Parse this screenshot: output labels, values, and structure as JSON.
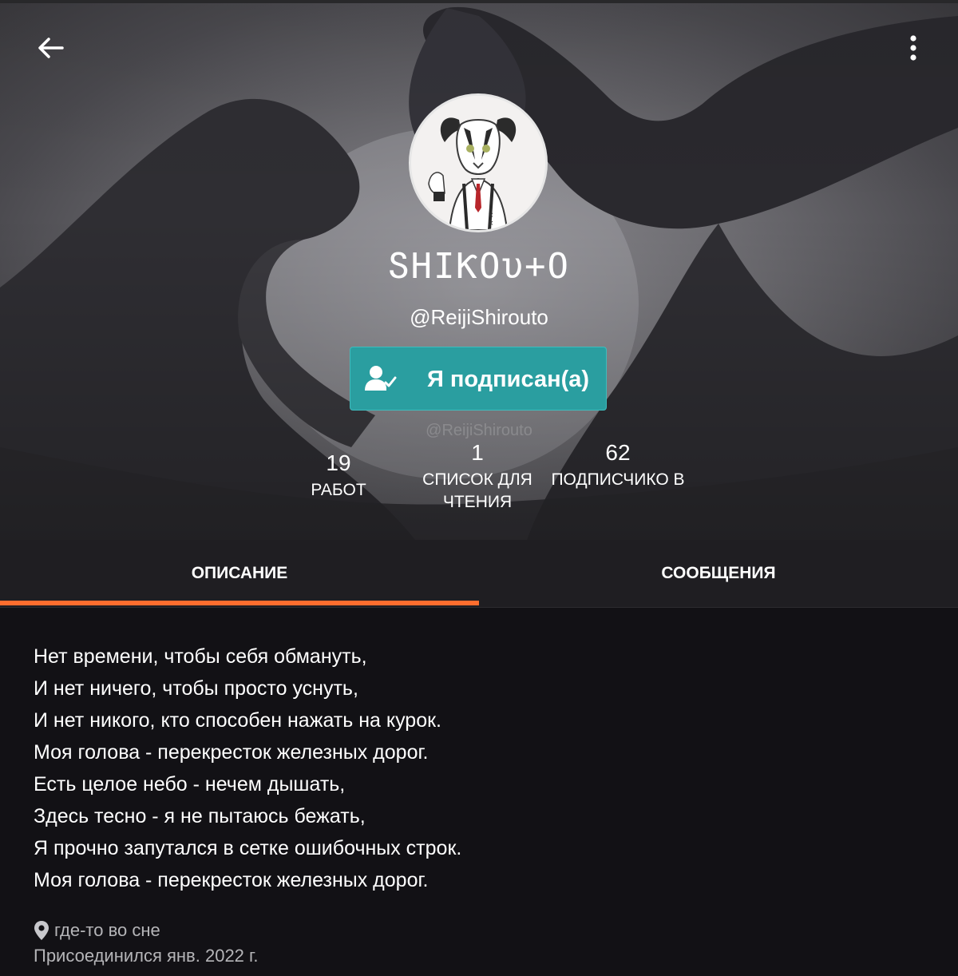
{
  "profile": {
    "display_name": "ՏHIƘOυ+O",
    "username": "@ReijiShirouto",
    "watermark": "@ReijiShirouto",
    "follow_label": "Я подписан(а)"
  },
  "stats": {
    "works": {
      "count": "19",
      "label": "РАБОТ"
    },
    "reading_lists": {
      "count": "1",
      "label": "СПИСОК ДЛЯ ЧТЕНИЯ"
    },
    "followers": {
      "count": "62",
      "label": "ПОДПИСЧИКО В"
    }
  },
  "tabs": {
    "description": "ОПИСАНИЕ",
    "messages": "СООБЩЕНИЯ"
  },
  "bio": {
    "lines": [
      "Нет времени, чтобы себя обмануть,",
      "И нет ничего, чтобы просто уснуть,",
      "И нет никого, кто способен нажать на курок.",
      "Моя голова - перекресток железных дорог.",
      "Есть целое небо - нечем дышать,",
      "Здесь тесно - я не пытаюсь бежать,",
      "Я прочно запутался в сетке ошибочных строк.",
      "Моя голова - перекресток железных дорог."
    ],
    "location": "где-то во сне",
    "joined": "Присоединился янв. 2022 г."
  },
  "colors": {
    "accent": "#ff6d2e",
    "follow_button": "#2a9ea0",
    "background": "#121115"
  },
  "icons": {
    "back": "arrow-left-icon",
    "more": "more-vertical-icon",
    "follow": "user-check-icon",
    "location": "map-pin-icon"
  }
}
